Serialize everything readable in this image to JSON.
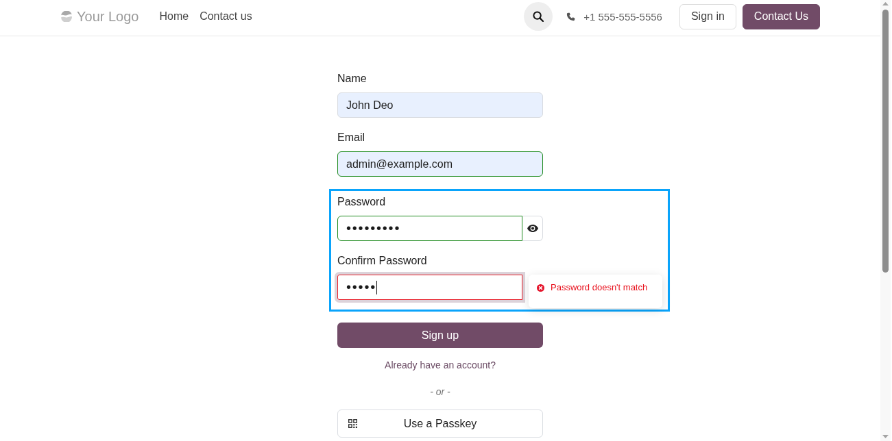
{
  "header": {
    "logo": {
      "text": "Your Logo"
    },
    "nav": [
      {
        "label": "Home"
      },
      {
        "label": "Contact us"
      }
    ],
    "phone": "+1 555-555-5556",
    "buttons": [
      {
        "label": "Sign in",
        "kind": "outline"
      },
      {
        "label": "Contact Us",
        "kind": "primary"
      }
    ]
  },
  "form": {
    "fields": [
      {
        "label": "Name",
        "value": "John Deo",
        "autofilled": true,
        "focused": false
      },
      {
        "label": "Email",
        "value": "admin@example.com",
        "autofilled": true,
        "valid": true,
        "focused": false
      }
    ],
    "password_section": {
      "highlighted": true,
      "fields": [
        {
          "label": "Password",
          "value": "•••••••••",
          "autofilled": false,
          "valid": true,
          "focused": false,
          "reveal_button": true
        },
        {
          "label": "Confirm Password",
          "value": "•••••",
          "autofilled": false,
          "valid": false,
          "focused": true,
          "reveal_button": false,
          "error": "Password doesn't match"
        }
      ]
    },
    "submit": "Sign up",
    "login_link": "Already have an account?",
    "separator": "- or -",
    "passkey_button": "Use a Passkey"
  }
}
